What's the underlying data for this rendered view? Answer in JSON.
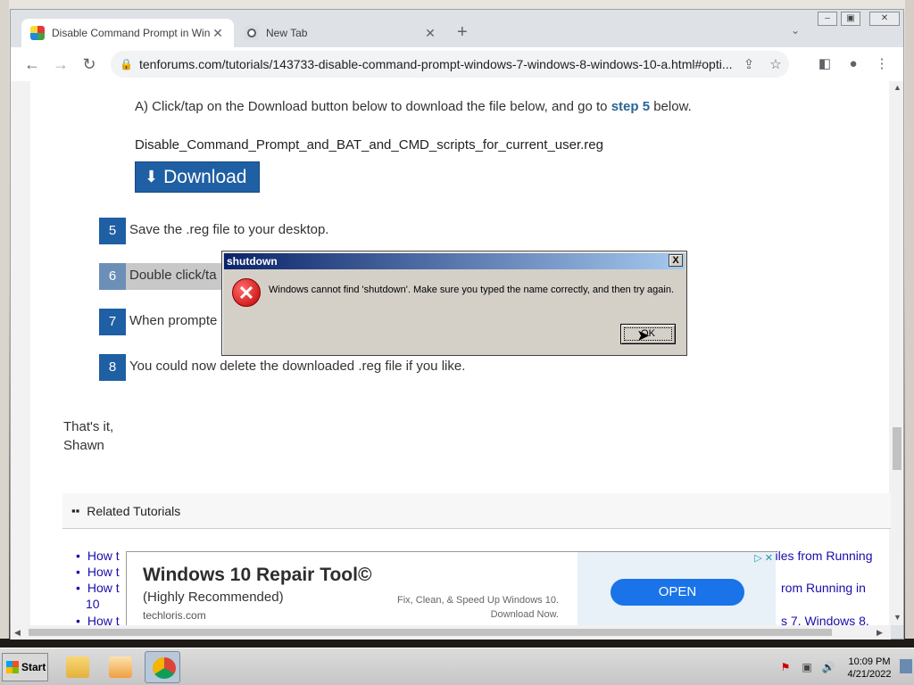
{
  "browser": {
    "tabs": [
      {
        "title": "Disable Command Prompt in Windo",
        "active": true,
        "favicon": "tenforums-icon"
      },
      {
        "title": "New Tab",
        "active": false,
        "favicon": "chrome-icon"
      }
    ],
    "new_tab_label": "+",
    "url": "tenforums.com/tutorials/143733-disable-command-prompt-windows-7-windows-8-windows-10-a.html#opti..."
  },
  "article": {
    "step_a_prefix": "A) Click/tap on the Download button below to download the file below, and go to",
    "step_a_link": "step 5",
    "step_a_suffix": "below.",
    "filename": "Disable_Command_Prompt_and_BAT_and_CMD_scripts_for_current_user.reg",
    "download_label": "Download",
    "steps": [
      {
        "num": "5",
        "text": "Save the .reg file to your desktop."
      },
      {
        "num": "6",
        "text": "Double click/ta"
      },
      {
        "num": "7",
        "text": "When prompte"
      },
      {
        "num": "8",
        "text": "You could now delete the downloaded .reg file if you like."
      }
    ],
    "signoff_1": "That's it,",
    "signoff_2": "Shawn",
    "related_title": "Related Tutorials",
    "related_items": [
      {
        "text": "How t"
      },
      {
        "text": "How t"
      },
      {
        "text": "How t"
      },
      {
        "text": "10"
      },
      {
        "text": "How t"
      }
    ],
    "related_right": [
      "Files from Running",
      "rom Running in",
      "s 7, Windows 8,"
    ]
  },
  "ad": {
    "title": "Windows 10 Repair Tool©",
    "subtitle": "(Highly Recommended)",
    "site": "techloris.com",
    "desc": "Fix, Clean, & Speed Up Windows 10. Download Now.",
    "cta": "OPEN"
  },
  "dialog": {
    "title": "shutdown",
    "message": "Windows cannot find 'shutdown'. Make sure you typed the name correctly, and then try again.",
    "ok_label": "OK",
    "close_label": "X"
  },
  "taskbar": {
    "start_label": "Start",
    "time": "10:09 PM",
    "date": "4/21/2022"
  },
  "colors": {
    "step_badge": "#1f5fa3",
    "link": "#2a6496",
    "dialog_title_start": "#0a246a",
    "dialog_title_end": "#a6caf0",
    "ad_button": "#1a73e8"
  }
}
